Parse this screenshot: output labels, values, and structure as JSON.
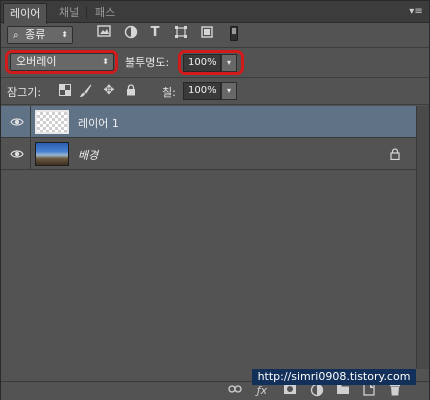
{
  "tabs": [
    {
      "label": "레이어",
      "active": true
    },
    {
      "label": "채널",
      "active": false
    },
    {
      "label": "패스",
      "active": false
    }
  ],
  "filter": {
    "kind_label": "종류",
    "icons": [
      "image-filter-icon",
      "adjustment-filter-icon",
      "type-filter-icon",
      "shape-filter-icon",
      "smart-object-filter-icon"
    ]
  },
  "blend": {
    "mode": "오버레이",
    "opacity_label": "불투명도:",
    "opacity_value": "100%"
  },
  "lock": {
    "label": "잠그기:",
    "fill_label": "칠:",
    "fill_value": "100%"
  },
  "layers": [
    {
      "name": "레이어 1",
      "selected": true,
      "visible": true,
      "thumbnail": "transparent",
      "locked": false
    },
    {
      "name": "배경",
      "selected": false,
      "visible": true,
      "thumbnail": "photo",
      "locked": true
    }
  ],
  "watermark": "http://simri0908.tistory.com",
  "colors": {
    "panel": "#535353",
    "selected_row": "#607286",
    "highlight": "#d11a1a"
  }
}
